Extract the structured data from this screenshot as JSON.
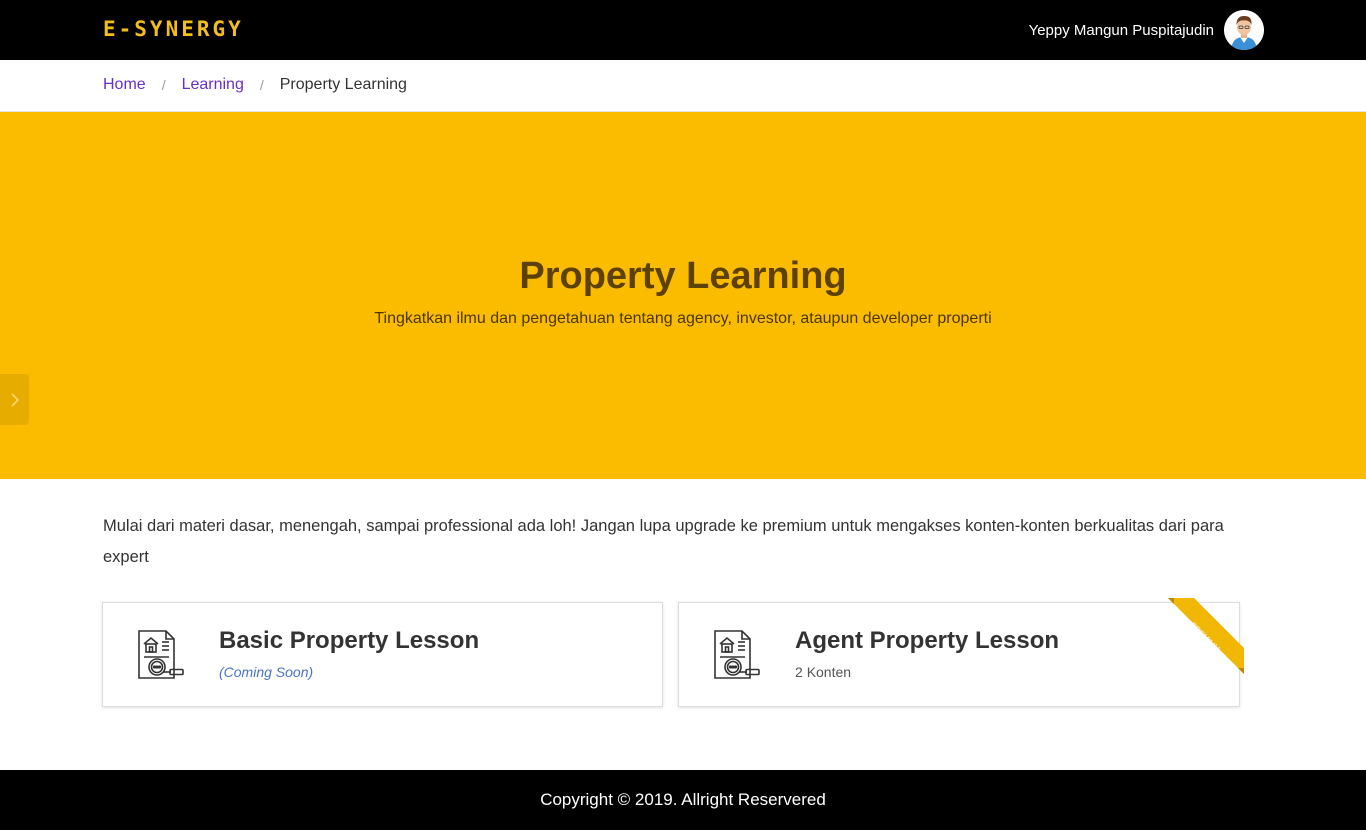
{
  "header": {
    "logo": "E-SYNERGY",
    "user_name": "Yeppy Mangun Puspitajudin"
  },
  "breadcrumb": {
    "items": [
      "Home",
      "Learning"
    ],
    "current": "Property Learning"
  },
  "hero": {
    "title": "Property Learning",
    "subtitle": "Tingkatkan ilmu dan pengetahuan tentang agency, investor, ataupun developer properti"
  },
  "intro": "Mulai dari materi dasar, menengah, sampai professional ada loh! Jangan lupa upgrade ke premium untuk mengakses konten-konten berkualitas dari para expert",
  "lessons": [
    {
      "title": "Basic Property Lesson",
      "status": "(Coming Soon)"
    },
    {
      "title": "Agent Property Lesson",
      "count": "2",
      "count_label": "Konten",
      "badge": "PREMIUM"
    }
  ],
  "footer": {
    "text": "Copyright © 2019. Allright Reservered"
  },
  "colors": {
    "brand_yellow": "#fbbc00",
    "logo_gold": "#f2be1c",
    "link_purple": "#6a2fc9",
    "coming_soon_blue": "#4a73c7"
  },
  "icons": [
    "avatar",
    "chevron-right-icon",
    "property-document-icon",
    "premium-ribbon"
  ]
}
